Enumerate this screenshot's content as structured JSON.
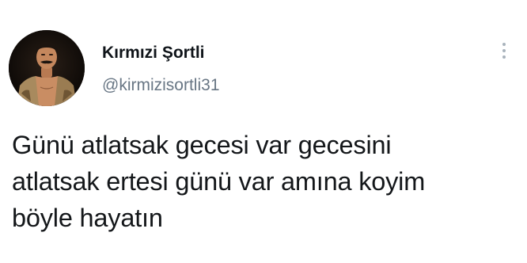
{
  "tweet": {
    "author": {
      "display_name": "Kırmızi Şortli",
      "handle": "@kirmizisortli31",
      "avatar_icon": "profile-photo"
    },
    "menu_icon": "vertical-dots-icon",
    "text_lines": [
      "Günü atlatsak gecesi var gecesini",
      "atlatsak ertesi günü var amına koyim",
      "böyle hayatın"
    ]
  }
}
